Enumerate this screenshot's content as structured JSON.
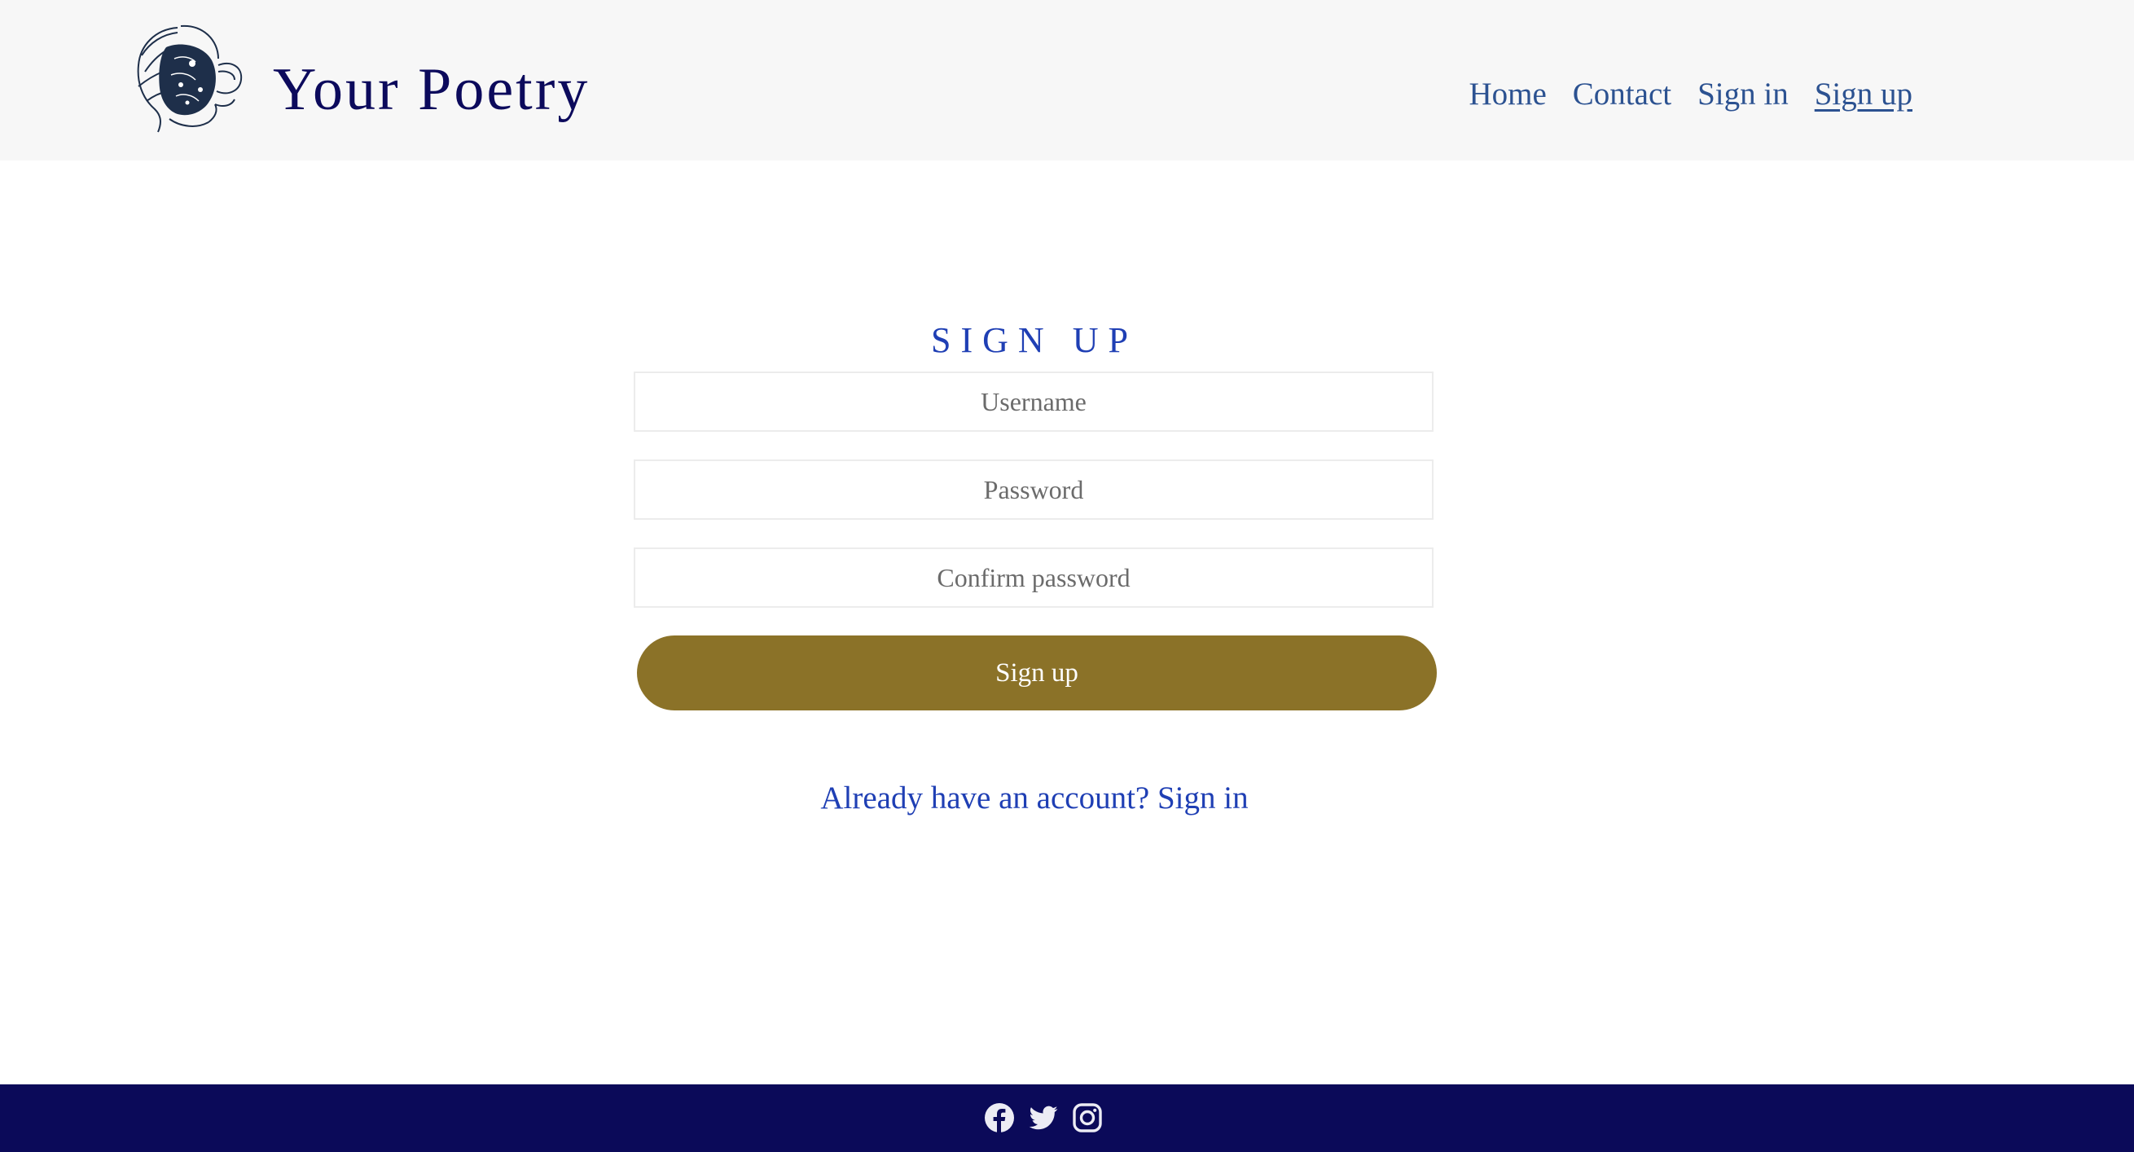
{
  "header": {
    "site_title": "Your Poetry",
    "nav": [
      {
        "label": "Home"
      },
      {
        "label": "Contact"
      },
      {
        "label": "Sign in"
      },
      {
        "label": "Sign up",
        "active": true
      }
    ]
  },
  "form": {
    "title": "SIGN UP",
    "username_placeholder": "Username",
    "password_placeholder": "Password",
    "confirm_placeholder": "Confirm password",
    "submit_label": "Sign up",
    "signin_link": "Already have an account? Sign in"
  },
  "footer": {
    "icons": [
      "facebook-icon",
      "twitter-icon",
      "instagram-icon"
    ]
  },
  "colors": {
    "header_bg": "#f7f7f7",
    "title": "#0c0a5c",
    "nav_link": "#2c5291",
    "accent_blue": "#1f3fb4",
    "button": "#8b7228",
    "footer_bg": "#0b0a59"
  }
}
